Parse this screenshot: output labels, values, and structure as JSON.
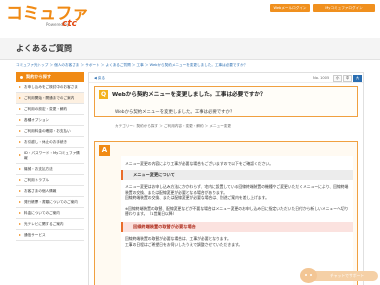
{
  "header": {
    "logo_main": "コミュファ",
    "logo_sub": "Powered by",
    "logo_ctc": "ctc",
    "btn_webmail": "Webメールログイン",
    "btn_mycommufa": "Myコミュファログイン"
  },
  "page_title": "よくあるご質問",
  "breadcrumb": "コミュファ光トップ ＞ 個人のお客さま ＞ サポート ＞ よくあるご質問 ＞ 工事 ＞ Webから契約メニューを変更しました。工事は必要ですか？",
  "sidebar": {
    "heading": "契約から探す",
    "items": [
      {
        "label": "お申し込みをご検討中のお客さま",
        "active": false
      },
      {
        "label": "ご利用開始・開通までのご案内",
        "active": true
      },
      {
        "label": "ご利用の設定・変更・解約",
        "active": false
      },
      {
        "label": "各種オプション",
        "active": false
      },
      {
        "label": "ご利用料金の確認・お支払い",
        "active": false
      },
      {
        "label": "お引越し・休止のお手続き",
        "active": false
      },
      {
        "label": "ID・パスワード・Myコミュファ情報",
        "active": false
      },
      {
        "label": "機械・お支払方法",
        "active": false
      },
      {
        "label": "ご利用トラブル",
        "active": false
      },
      {
        "label": "お客さまの個人情報",
        "active": false
      },
      {
        "label": "発行帳票・書類についてのご案内",
        "active": false
      },
      {
        "label": "料金についてのご案内",
        "active": false
      },
      {
        "label": "光テレビに関するご案内",
        "active": false
      },
      {
        "label": "通信サービス",
        "active": false
      }
    ]
  },
  "main": {
    "back_link": "戻る",
    "question_no": "No. 1005",
    "font_sizes": [
      "小",
      "中",
      "大"
    ],
    "question": {
      "badge": "Q",
      "title": "Webから契約メニューを変更しました。工事は必要ですか？",
      "sub": "Webから契約メニューを変更しました。工事は必要ですか？",
      "category": "カテゴリー：契約から探す ＞ ご利用内容・変更・解約 ＞ メニュー変更"
    },
    "answer": {
      "badge": "A",
      "intro": "メニュー変更の内容により工事が必要な場合もございますので以下をご確認ください。",
      "section1_title": "メニュー変更について",
      "section1_p1": "メニュー変更はお申し込み方法にかかわらず、宅内に設置している回線終端装置の機種やご変更いただくメニューにより、回線終端装置の交換、または配線変更が必要となる場合があります。",
      "section1_p2": "回線終端装置の交換、または配線変更が必要な場合は、別途ご案内を差し上げます。",
      "section1_note": "※回線終端装置の取替、配線変更などが不要な場合はメニュー変更のお申し込み日に指定いただいた日付から新しいメニューへ切り替わります。（1営業日以降）",
      "section2_title": "回線終端装置の取替が必要な場合",
      "section2_p1": "回線終端装置の取替が必要な場合は、工事が必要となります。",
      "section2_p2": "工事の日程はご希望日をお伺いしたうえで調整させていただきます。"
    }
  },
  "chat_label": "チャットでサポート"
}
